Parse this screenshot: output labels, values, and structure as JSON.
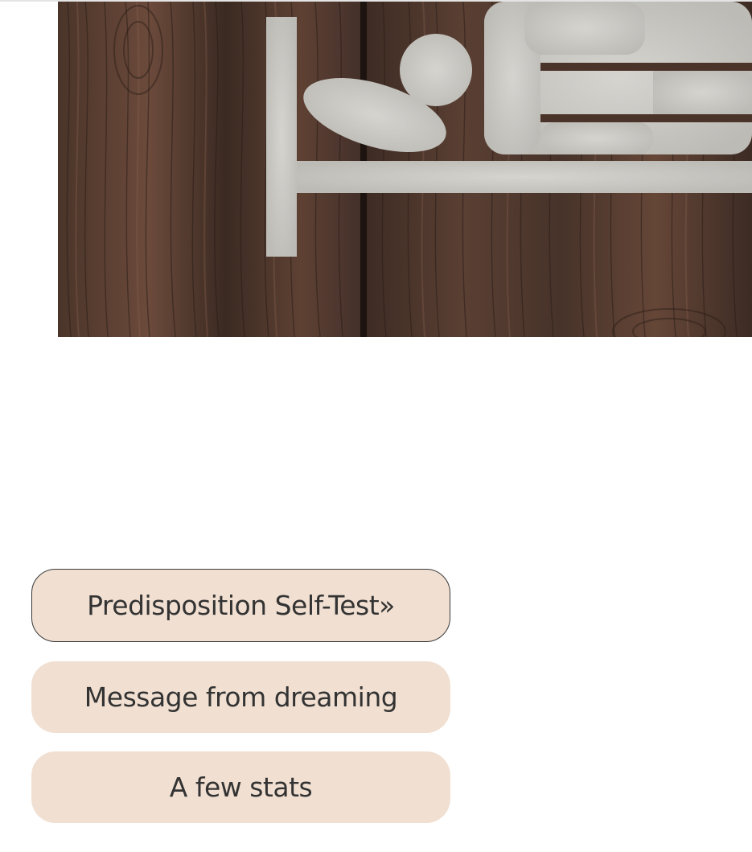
{
  "hero": {
    "icon": "bed-sleeping-person-icon",
    "background": "dark-wood-planks",
    "colors": {
      "wood_dark": "#3a2a22",
      "wood_light": "#7a5645",
      "icon_fill": "#c6c4bf"
    }
  },
  "menu": {
    "items": [
      {
        "label": "Predisposition Self-Test»",
        "active": true
      },
      {
        "label": "Message from dreaming",
        "active": false
      },
      {
        "label": "A few stats",
        "active": false
      }
    ],
    "colors": {
      "button_bg": "#f1e0d2",
      "button_text": "#333333",
      "active_border": "#3a3a3a"
    }
  }
}
